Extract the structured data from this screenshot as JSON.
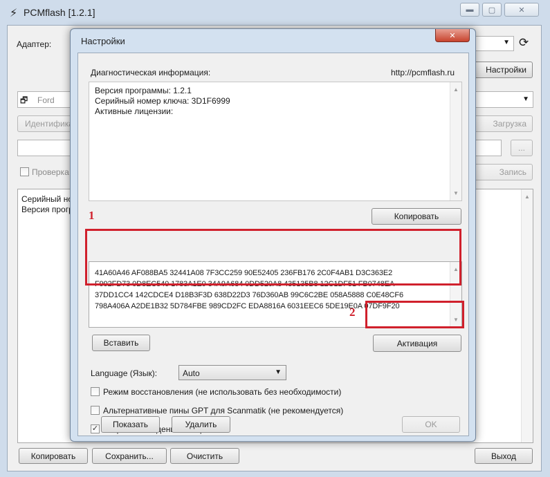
{
  "main": {
    "title": "PCMflash [1.2.1]",
    "adapter_label": "Адаптер:",
    "settings_button": "Настройки",
    "vehicle_value": "Ford",
    "identify_button": "Идентифика",
    "download_button": "Загрузка",
    "verify_checkbox_label": "Проверка",
    "write_button": "Запись",
    "browse_button": "...",
    "log_lines": [
      "Серийный но",
      "Версия прогр"
    ],
    "bottom_buttons": {
      "copy": "Копировать",
      "save": "Сохранить...",
      "clear": "Очистить",
      "exit": "Выход"
    }
  },
  "dialog": {
    "title": "Настройки",
    "close_glyph": "✕",
    "diag_label": "Диагностическая информация:",
    "site_url": "http://pcmflash.ru",
    "diag_lines": [
      "Версия программы: 1.2.1",
      "Серийный номер ключа: 3D1F6999",
      "Активные лицензии:"
    ],
    "copy_button": "Копировать",
    "license_lines": [
      "41A60A46 AF088BA5 32441A08 7F3CC259 90E52405 236FB176 2C0F4AB1 D3C363E2",
      "F992FD73 0D8EC540 1783A1E0 34A9A684 0DD520A8 435135B8 12C1DF51 FB0748EA",
      "37DD1CC4 142CDCE4 D18B3F3D 638D22D3 76D360AB 99C6C2BE 058A5888 C0E48CF6",
      "798A406A A2DE1B32 5D784FBE 989CD2FC EDA8816A 6031EEC6 5DE19E0A 07DF9F20"
    ],
    "paste_button": "Вставить",
    "activate_button": "Активация",
    "language_label": "Language (Язык):",
    "language_value": "Auto",
    "checkboxes": [
      {
        "label": "Режим восстановления (не использовать без необходимости)",
        "checked": false
      },
      {
        "label": "Альтернативные пины GPT для Scanmatik (не рекомендуется)",
        "checked": false
      },
      {
        "label": "Разрешить ведение лог-файла",
        "checked": true
      }
    ],
    "show_button": "Показать",
    "delete_button": "Удалить",
    "ok_button": "OK"
  },
  "annotations": {
    "box1_number": "1",
    "box2_number": "2"
  },
  "colors": {
    "annotation_red": "#d0202c",
    "window_frame": "#cfdceb",
    "dialog_frame": "#d3e1f0"
  }
}
